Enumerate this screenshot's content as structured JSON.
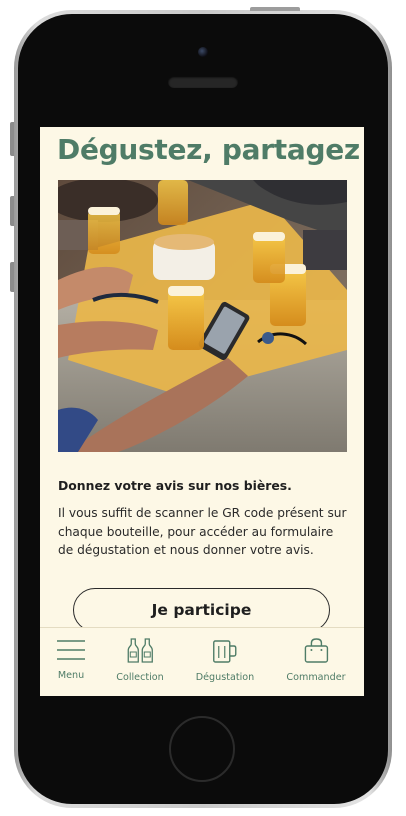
{
  "page": {
    "title": "Dégustez, partagez !",
    "hero_image": "friends-sharing-beers-with-smartphones",
    "subtitle": "Donnez votre avis sur nos bières.",
    "body": "Il vous suffit de scanner le GR code présent sur chaque bouteille, pour accéder au formulaire de dégustation et nous donner votre avis.",
    "cta_label": "Je participe"
  },
  "nav": {
    "items": [
      {
        "label": "Menu",
        "icon": "hamburger-icon"
      },
      {
        "label": "Collection",
        "icon": "bottles-icon"
      },
      {
        "label": "Dégustation",
        "icon": "beer-mug-icon"
      },
      {
        "label": "Commander",
        "icon": "shopping-bag-icon"
      }
    ]
  },
  "colors": {
    "accent_green": "#4f7c67",
    "background_cream": "#fdf8e6",
    "text_dark": "#1f1f1f",
    "device_black": "#0b0b0b"
  }
}
